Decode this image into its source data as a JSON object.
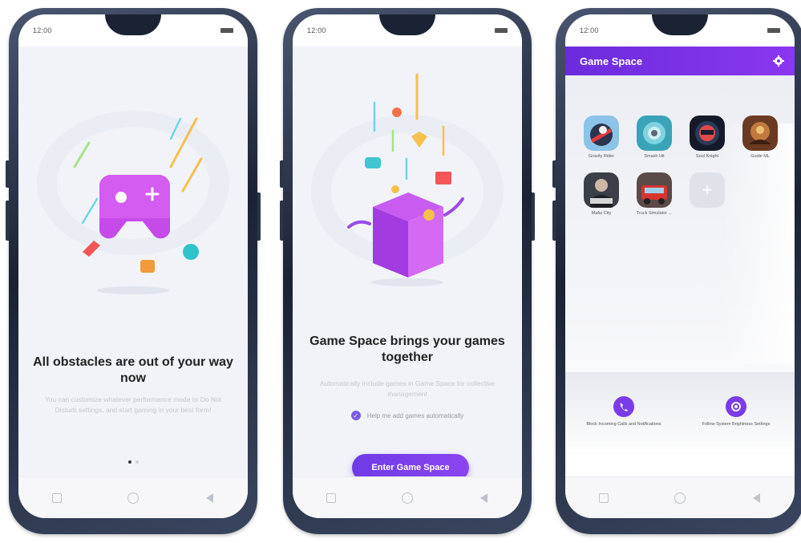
{
  "status_time": "12:00",
  "phones": [
    {
      "headline": "All obstacles are out of your way now",
      "subtext": "You can customize whatever performance mode or Do Not Disturb settings, and start gaming in your best form!"
    },
    {
      "headline": "Game Space brings your games together",
      "subtext": "Automatically include games in Game Space for collective management",
      "checkbox_label": "Help me add games automatically",
      "enter_button": "Enter Game Space"
    },
    {
      "header_title": "Game Space",
      "games": [
        {
          "name": "Gravity Rider"
        },
        {
          "name": "Smash Hit"
        },
        {
          "name": "Soul Knight"
        },
        {
          "name": "Guide ML"
        },
        {
          "name": "Mafia City"
        },
        {
          "name": "Truck Simulator ..."
        }
      ],
      "actions": [
        {
          "label": "Block Incoming Calls and Notifications"
        },
        {
          "label": "Follow System Brightness Settings"
        }
      ]
    }
  ],
  "colors": {
    "accent": "#7a3be8",
    "header_gradient_start": "#6a2cdb",
    "header_gradient_end": "#8b36f2"
  }
}
